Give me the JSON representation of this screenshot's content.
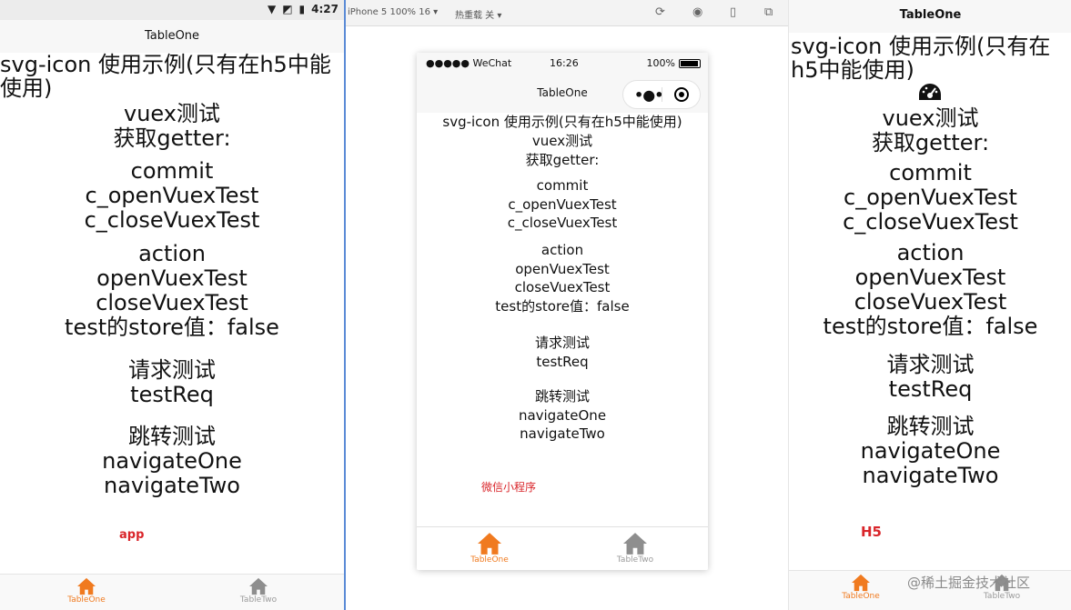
{
  "app": {
    "status_time": "4:27",
    "nav_title": "TableOne",
    "heading": "svg-icon 使用示例(只有在h5中能使用)",
    "vuex": [
      "vuex测试",
      "获取getter:"
    ],
    "commit": [
      "commit",
      "c_openVuexTest",
      "c_closeVuexTest"
    ],
    "action": [
      "action",
      "openVuexTest",
      "closeVuexTest",
      "test的store值：false"
    ],
    "request": [
      "请求测试",
      "testReq"
    ],
    "navigate": [
      "跳转测试",
      "navigateOne",
      "navigateTwo"
    ],
    "platform_label": "app",
    "tabs": [
      "TableOne",
      "TableTwo"
    ]
  },
  "devtools": {
    "device": "iPhone 5 100% 16 ▾",
    "hot_reload": "热重载 关 ▾"
  },
  "wechat": {
    "carrier": "●●●●● WeChat",
    "time": "16:26",
    "battery": "100%",
    "nav_title": "TableOne",
    "heading": "svg-icon 使用示例(只有在h5中能使用)",
    "vuex": [
      "vuex测试",
      "获取getter:"
    ],
    "commit": [
      "commit",
      "c_openVuexTest",
      "c_closeVuexTest"
    ],
    "action": [
      "action",
      "openVuexTest",
      "closeVuexTest",
      "test的store值：false"
    ],
    "request": [
      "请求测试",
      "testReq"
    ],
    "navigate": [
      "跳转测试",
      "navigateOne",
      "navigateTwo"
    ],
    "platform_label": "微信小程序",
    "tabs": [
      "TableOne",
      "TableTwo"
    ]
  },
  "h5": {
    "nav_title": "TableOne",
    "heading": "svg-icon 使用示例(只有在h5中能使用)",
    "vuex": [
      "vuex测试",
      "获取getter:"
    ],
    "commit": [
      "commit",
      "c_openVuexTest",
      "c_closeVuexTest"
    ],
    "action": [
      "action",
      "openVuexTest",
      "closeVuexTest",
      "test的store值：false"
    ],
    "request": [
      "请求测试",
      "testReq"
    ],
    "navigate": [
      "跳转测试",
      "navigateOne",
      "navigateTwo"
    ],
    "platform_label": "H5",
    "tabs": [
      "TableOne",
      "TableTwo"
    ],
    "watermark": "@稀土掘金技术社区"
  },
  "colors": {
    "accent": "#f07a1f",
    "inactive": "#9a9a9a",
    "platform": "#d9252a"
  },
  "icons": [
    "wifi-icon",
    "battery-icon",
    "home-icon",
    "gauge-icon",
    "refresh-icon",
    "record-icon",
    "phone-icon",
    "window-icon",
    "more-dots-icon",
    "capsule-close-icon"
  ]
}
